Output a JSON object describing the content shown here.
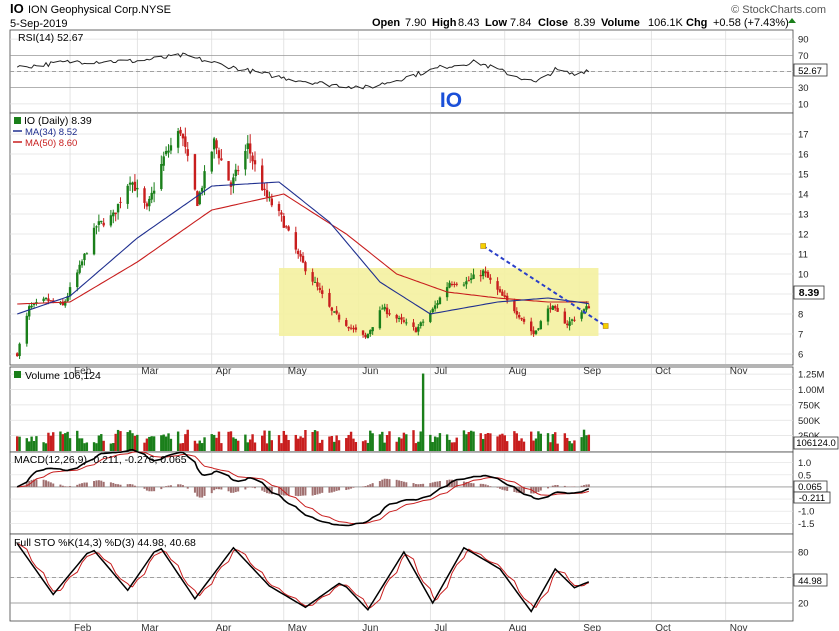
{
  "header": {
    "symbol": "IO",
    "company": "ION Geophysical Corp.",
    "exchange": "NYSE",
    "date": "5-Sep-2019",
    "watermark": "© StockCharts.com",
    "quote": {
      "open_label": "Open",
      "open": "7.90",
      "high_label": "High",
      "high": "8.43",
      "low_label": "Low",
      "low": "7.84",
      "close_label": "Close",
      "close": "8.39",
      "volume_label": "Volume",
      "volume": "106.1K",
      "chg_label": "Chg",
      "chg": "+0.58 (+7.43%)"
    }
  },
  "rsi": {
    "label": "RSI(14) 52.67",
    "current_tag": "52.67",
    "ticks": [
      90,
      70,
      50,
      30,
      10
    ],
    "annotation": "IO"
  },
  "price": {
    "legend": [
      "IO (Daily) 8.39",
      "MA(34) 8.52",
      "MA(50) 8.60"
    ],
    "current_tag": "8.39",
    "ticks": [
      17,
      16,
      15,
      14,
      13,
      12,
      11,
      10,
      9,
      8,
      7,
      6
    ]
  },
  "volume": {
    "label": "Volume 106,124",
    "current_tag": "106124.0",
    "ticks": [
      "1.25M",
      "1.00M",
      "750K",
      "500K",
      "250K"
    ]
  },
  "macd": {
    "label": "MACD(12,26,9) -0.211, -0.276, 0.065",
    "tags": [
      "0.065",
      "-0.211"
    ],
    "ticks": [
      "1.0",
      "0.5",
      "0.0",
      "-0.5",
      "-1.0",
      "-1.5"
    ]
  },
  "sto": {
    "label": "Full STO %K(14,3) %D(3) 44.98, 40.68",
    "current_tag": "44.98",
    "ticks": [
      80,
      50,
      20
    ]
  },
  "months": [
    "Feb",
    "Mar",
    "Apr",
    "May",
    "Jun",
    "Jul",
    "Aug",
    "Sep",
    "Oct",
    "Nov"
  ],
  "colors": {
    "up": "#1a7f1a",
    "down": "#c81e1e",
    "ma34": "#1f2f8f",
    "ma50": "#c81e1e",
    "trendline": "#2a3fc8",
    "box": "#f4f1a0",
    "annotation": "#1a4fd8"
  },
  "chart_data": {
    "type": "candlestick",
    "series_key_points": {
      "close": [
        [
          "2019-01-10",
          6.0
        ],
        [
          "2019-01-15",
          8.3
        ],
        [
          "2019-01-22",
          8.7
        ],
        [
          "2019-01-29",
          8.4
        ],
        [
          "2019-02-05",
          10.3
        ],
        [
          "2019-02-12",
          12.4
        ],
        [
          "2019-02-19",
          12.9
        ],
        [
          "2019-02-26",
          14.8
        ],
        [
          "2019-03-05",
          13.2
        ],
        [
          "2019-03-12",
          15.8
        ],
        [
          "2019-03-19",
          17.2
        ],
        [
          "2019-03-26",
          13.6
        ],
        [
          "2019-04-02",
          16.6
        ],
        [
          "2019-04-09",
          14.4
        ],
        [
          "2019-04-16",
          16.4
        ],
        [
          "2019-04-23",
          14.0
        ],
        [
          "2019-04-30",
          12.8
        ],
        [
          "2019-05-07",
          10.9
        ],
        [
          "2019-05-14",
          9.5
        ],
        [
          "2019-05-21",
          8.1
        ],
        [
          "2019-05-28",
          7.4
        ],
        [
          "2019-06-04",
          6.8
        ],
        [
          "2019-06-11",
          8.3
        ],
        [
          "2019-06-18",
          7.7
        ],
        [
          "2019-06-25",
          7.2
        ],
        [
          "2019-07-02",
          8.2
        ],
        [
          "2019-07-09",
          9.6
        ],
        [
          "2019-07-16",
          9.6
        ],
        [
          "2019-07-23",
          10.1
        ],
        [
          "2019-07-30",
          9.0
        ],
        [
          "2019-08-06",
          8.1
        ],
        [
          "2019-08-13",
          7.0
        ],
        [
          "2019-08-20",
          8.4
        ],
        [
          "2019-08-27",
          7.5
        ],
        [
          "2019-09-05",
          8.39
        ]
      ],
      "ma34": [
        [
          "2019-01-10",
          8.0
        ],
        [
          "2019-02-01",
          8.9
        ],
        [
          "2019-03-01",
          11.8
        ],
        [
          "2019-04-01",
          14.4
        ],
        [
          "2019-04-29",
          14.6
        ],
        [
          "2019-05-20",
          12.6
        ],
        [
          "2019-06-10",
          9.6
        ],
        [
          "2019-07-01",
          8.0
        ],
        [
          "2019-07-29",
          8.6
        ],
        [
          "2019-08-19",
          8.8
        ],
        [
          "2019-09-05",
          8.52
        ]
      ],
      "ma50": [
        [
          "2019-01-10",
          8.5
        ],
        [
          "2019-02-01",
          8.6
        ],
        [
          "2019-03-01",
          10.6
        ],
        [
          "2019-04-01",
          13.2
        ],
        [
          "2019-05-01",
          14.0
        ],
        [
          "2019-05-27",
          12.0
        ],
        [
          "2019-06-17",
          10.0
        ],
        [
          "2019-07-08",
          9.1
        ],
        [
          "2019-07-29",
          8.8
        ],
        [
          "2019-08-19",
          8.6
        ],
        [
          "2019-09-05",
          8.6
        ]
      ],
      "rsi": [
        [
          "2019-01-10",
          55
        ],
        [
          "2019-02-01",
          62
        ],
        [
          "2019-03-01",
          63
        ],
        [
          "2019-03-20",
          70
        ],
        [
          "2019-04-10",
          55
        ],
        [
          "2019-05-01",
          42
        ],
        [
          "2019-05-20",
          34
        ],
        [
          "2019-06-05",
          30
        ],
        [
          "2019-06-20",
          42
        ],
        [
          "2019-07-05",
          55
        ],
        [
          "2019-07-20",
          62
        ],
        [
          "2019-08-05",
          45
        ],
        [
          "2019-08-14",
          36
        ],
        [
          "2019-08-22",
          52
        ],
        [
          "2019-08-30",
          46
        ],
        [
          "2019-09-05",
          52.67
        ]
      ],
      "volume_spike": [
        "2019-06-28",
        1260000
      ],
      "sto_k": [
        [
          "2019-01-10",
          90
        ],
        [
          "2019-01-25",
          30
        ],
        [
          "2019-02-10",
          85
        ],
        [
          "2019-02-25",
          35
        ],
        [
          "2019-03-10",
          88
        ],
        [
          "2019-03-25",
          25
        ],
        [
          "2019-04-10",
          85
        ],
        [
          "2019-04-25",
          40
        ],
        [
          "2019-05-10",
          15
        ],
        [
          "2019-05-25",
          45
        ],
        [
          "2019-06-05",
          12
        ],
        [
          "2019-06-20",
          80
        ],
        [
          "2019-07-02",
          20
        ],
        [
          "2019-07-15",
          85
        ],
        [
          "2019-07-30",
          60
        ],
        [
          "2019-08-12",
          10
        ],
        [
          "2019-08-22",
          60
        ],
        [
          "2019-08-30",
          38
        ],
        [
          "2019-09-05",
          44.98
        ]
      ]
    },
    "xlim": [
      "2019-01-07",
      "2019-11-29"
    ],
    "price_ylim": [
      5.5,
      18
    ],
    "rsi_ylim": [
      0,
      100
    ],
    "volume_ylim": [
      0,
      1350000
    ],
    "macd_ylim": [
      -1.9,
      1.4
    ],
    "sto_ylim": [
      0,
      100
    ],
    "annotations": {
      "box": {
        "x": [
          "2019-04-29",
          "2019-09-09"
        ],
        "y": [
          6.9,
          10.3
        ]
      },
      "trendline": {
        "from": [
          "2019-07-23",
          11.4
        ],
        "to": [
          "2019-09-12",
          7.4
        ]
      }
    }
  }
}
